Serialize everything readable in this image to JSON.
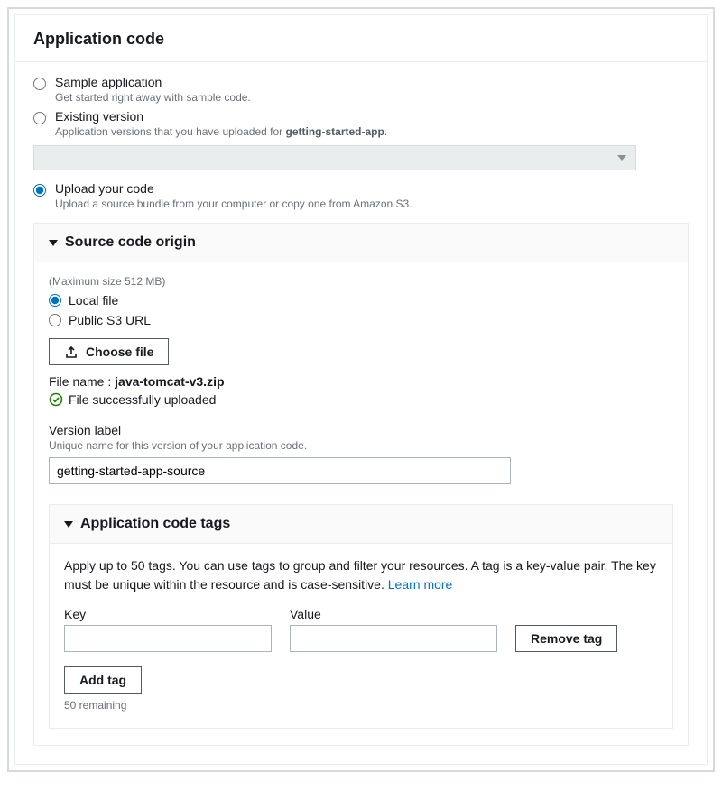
{
  "section": {
    "title": "Application code"
  },
  "options": {
    "sample": {
      "label": "Sample application",
      "desc": "Get started right away with sample code.",
      "selected": false
    },
    "existing": {
      "label": "Existing version",
      "desc_prefix": "Application versions that you have uploaded for ",
      "desc_bold": "getting-started-app",
      "desc_suffix": ".",
      "selected": false
    },
    "upload": {
      "label": "Upload your code",
      "desc": "Upload a source bundle from your computer or copy one from Amazon S3.",
      "selected": true
    }
  },
  "source_origin": {
    "title": "Source code origin",
    "max_size_hint": "(Maximum size 512 MB)",
    "local_label": "Local file",
    "local_selected": true,
    "s3_label": "Public S3 URL",
    "s3_selected": false,
    "choose_file_label": "Choose file",
    "file_name_label": "File name :",
    "file_name_value": "java-tomcat-v3.zip",
    "success_message": "File successfully uploaded"
  },
  "version": {
    "label": "Version label",
    "desc": "Unique name for this version of your application code.",
    "value": "getting-started-app-source"
  },
  "tags": {
    "title": "Application code tags",
    "desc": "Apply up to 50 tags. You can use tags to group and filter your resources. A tag is a key-value pair. The key must be unique within the resource and is case-sensitive. ",
    "learn_more": "Learn more",
    "key_label": "Key",
    "value_label": "Value",
    "key_value": "",
    "value_value": "",
    "remove_label": "Remove tag",
    "add_label": "Add tag",
    "remaining": "50 remaining"
  }
}
